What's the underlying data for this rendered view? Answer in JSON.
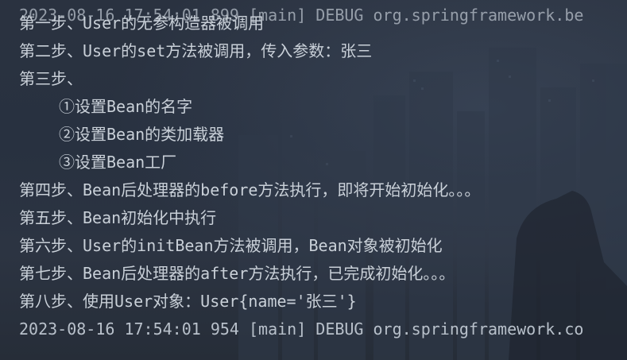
{
  "console": {
    "top_partial_log": "2023-08-16 17:54:01 899 [main] DEBUG org.springframework.be",
    "lines": [
      "第一步、User的无参构造器被调用",
      "第二步、User的set方法被调用，传入参数：张三",
      "第三步、",
      "①设置Bean的名字",
      "②设置Bean的类加载器",
      "③设置Bean工厂",
      "第四步、Bean后处理器的before方法执行，即将开始初始化。。。",
      "第五步、Bean初始化中执行",
      "第六步、User的initBean方法被调用，Bean对象被初始化",
      "第七步、Bean后处理器的after方法执行，已完成初始化。。。",
      "第八步、使用User对象：User{name='张三'}"
    ],
    "bottom_log": "2023-08-16 17:54:01 954 [main] DEBUG org.springframework.co"
  },
  "colors": {
    "background": "#283140",
    "text": "#c9d0d8"
  }
}
